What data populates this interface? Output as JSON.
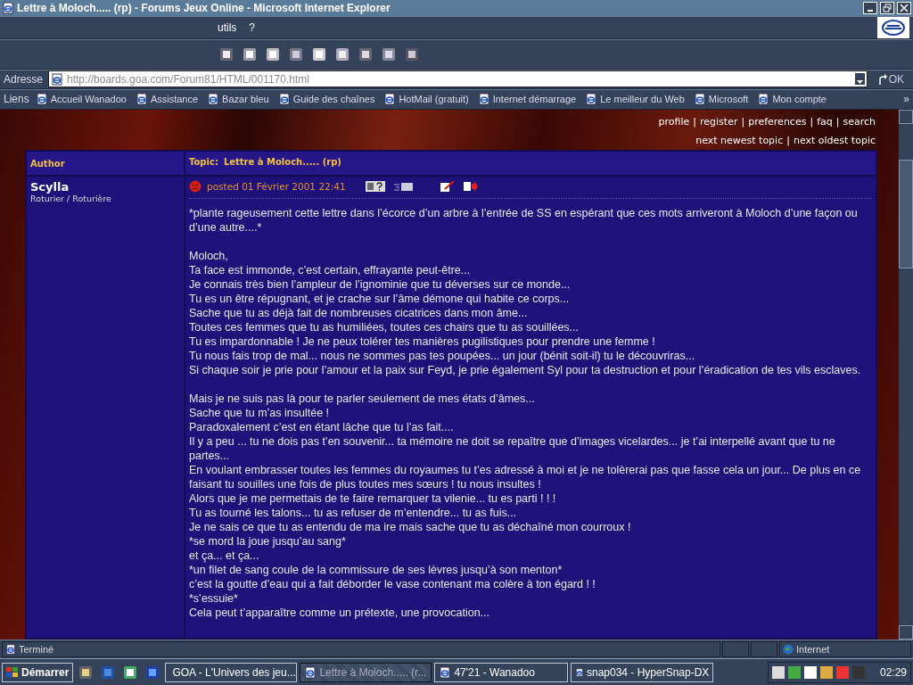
{
  "window": {
    "title": "Lettre à Moloch..... (rp) - Forums Jeux Online - Microsoft Internet Explorer"
  },
  "menu": [
    "utils",
    "?"
  ],
  "address": {
    "label": "Adresse",
    "value": "http://boards.goa.com/Forum81/HTML/001170.html",
    "go": "OK"
  },
  "links": {
    "label": "Liens",
    "more": "»",
    "items": [
      "Accueil Wanadoo",
      "Assistance",
      "Bazar bleu",
      "Guide des chaînes",
      "HotMail (gratuit)",
      "Internet démarrage",
      "Le meilleur du Web",
      "Microsoft",
      "Mon compte"
    ]
  },
  "forum": {
    "separator": "|",
    "nav_top": [
      "profile",
      "register",
      "preferences",
      "faq",
      "search"
    ],
    "nav_topic": [
      "next newest topic",
      "next oldest topic"
    ],
    "header": {
      "author": "Author",
      "topic_label": "Topic:",
      "topic": "Lettre à Moloch..... (rp)"
    },
    "post": {
      "author": "Scylla",
      "rank": "Roturier / Roturière",
      "posted": "posted 01 Février 2001 22:41",
      "paragraphs": [
        {
          "lines": [
            "*plante rageusement cette lettre dans l’écorce d’un arbre à l’entrée de SS en espérant que ces mots arriveront à Moloch d’une façon ou d’une autre....*"
          ]
        },
        {
          "lines": [
            "Moloch,",
            "Ta face est immonde, c’est certain, effrayante peut-être...",
            "Je connais très bien l’ampleur de l’ignominie que tu déverses sur ce monde...",
            "Tu es un être répugnant, et je crache sur l’âme démone qui habite ce corps...",
            "Sache que tu as déjà fait de nombreuses cicatrices dans mon âme...",
            "Toutes ces femmes que tu as humiliées, toutes ces chairs que tu as souillées...",
            "Tu es impardonnable ! Je ne peux tolérer tes manières pugilistiques pour prendre une femme !",
            "Tu nous fais trop de mal... nous ne sommes pas tes poupées... un jour (bénit soit-il) tu le découvriras...",
            "Si chaque soir je prie pour l’amour et la paix sur Feyd, je prie également Syl pour ta destruction et pour l’éradication de tes vils esclaves."
          ]
        },
        {
          "lines": [
            "Mais je ne suis pas là pour te parler seulement de mes états d’âmes...",
            "Sache que tu m’as insultée !",
            "Paradoxalement c’est en étant lâche que tu l’as fait....",
            "Il y a peu ... tu ne dois pas t’en souvenir... ta mémoire ne doit se repaître que d’images vicelardes... je t’ai interpellé avant que tu ne partes...",
            "En voulant embrasser toutes les femmes du royaumes tu t’es adressé à moi et je ne tolèrerai pas que fasse cela un jour... De plus en ce faisant tu souilles une fois de plus toutes mes sœurs ! tu nous insultes !",
            "Alors que je me permettais de te faire remarquer ta vilenie... tu es parti ! ! !",
            "Tu as tourné les talons... tu as refuser de m’entendre... tu as fuis...",
            "Je ne sais ce que tu as entendu de ma ire mais sache que tu as déchaîné mon courroux !",
            "*se mord la joue jusqu’au sang*",
            "et ça... et ça...",
            "*un filet de sang coule de la commissure de ses lèvres jusqu’à son menton*",
            "c’est la goutte d’eau qui a fait déborder le vase contenant ma colère à ton égard ! !",
            "*s’essuie*",
            "Cela peut t’apparaître comme un prétexte, une provocation..."
          ]
        }
      ]
    }
  },
  "status_bar": {
    "text": "Terminé",
    "zone": "Internet"
  },
  "taskbar": {
    "start": "Démarrer",
    "tasks": [
      {
        "label": "GOA - L'Univers des jeu...",
        "selected": false
      },
      {
        "label": "Lettre à Moloch..... (r...",
        "selected": true
      },
      {
        "label": "47'21 - Wanadoo",
        "selected": false
      },
      {
        "label": "snap034 - HyperSnap-DX",
        "selected": false
      }
    ],
    "clock": "02:29"
  }
}
